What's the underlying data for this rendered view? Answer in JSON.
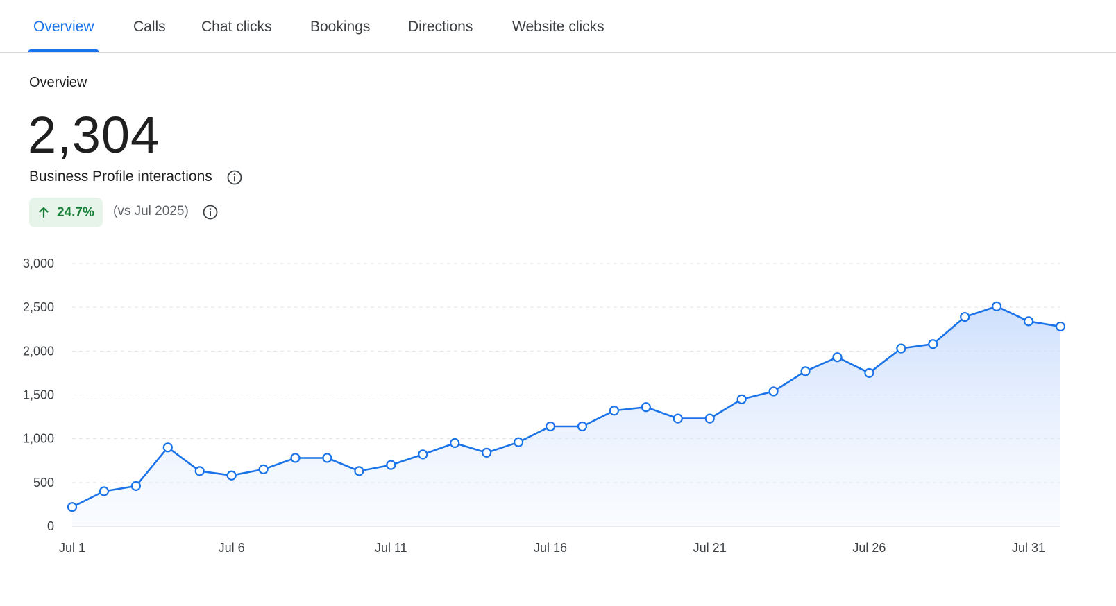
{
  "tabs": [
    {
      "label": "Overview",
      "active": true
    },
    {
      "label": "Calls",
      "active": false
    },
    {
      "label": "Chat clicks",
      "active": false
    },
    {
      "label": "Bookings",
      "active": false
    },
    {
      "label": "Directions",
      "active": false
    },
    {
      "label": "Website clicks",
      "active": false
    }
  ],
  "summary": {
    "section_label": "Overview",
    "total": "2,304",
    "metric_label": "Business Profile interactions",
    "delta": "24.7%",
    "delta_direction": "up",
    "comparison": "(vs Jul 2025)"
  },
  "icons": {
    "info": "info-icon",
    "delta": "arrow-up-icon"
  },
  "colors": {
    "accent": "#1a73e8",
    "positive": "#188038",
    "positive_bg": "#e6f4ea"
  },
  "chart_data": {
    "type": "area",
    "x": [
      "Jul 1",
      "Jul 2",
      "Jul 3",
      "Jul 4",
      "Jul 5",
      "Jul 6",
      "Jul 7",
      "Jul 8",
      "Jul 9",
      "Jul 10",
      "Jul 11",
      "Jul 12",
      "Jul 13",
      "Jul 14",
      "Jul 15",
      "Jul 16",
      "Jul 17",
      "Jul 18",
      "Jul 19",
      "Jul 20",
      "Jul 21",
      "Jul 22",
      "Jul 23",
      "Jul 24",
      "Jul 25",
      "Jul 26",
      "Jul 27",
      "Jul 28",
      "Jul 29",
      "Jul 30",
      "Jul 31"
    ],
    "series": [
      {
        "values": [
          220,
          400,
          460,
          900,
          630,
          580,
          650,
          780,
          780,
          630,
          700,
          820,
          950,
          840,
          960,
          1140,
          1140,
          1320,
          1360,
          1230,
          1230,
          1450,
          1540,
          1770,
          1930,
          1750,
          2030,
          2080,
          2390,
          2510,
          2340,
          2280
        ]
      }
    ],
    "x_tick_labels": [
      "Jul 1",
      "Jul 6",
      "Jul 11",
      "Jul 16",
      "Jul 21",
      "Jul 26",
      "Jul 31"
    ],
    "y_ticks": [
      0,
      500,
      1000,
      1500,
      2000,
      2500,
      3000
    ],
    "y_tick_labels": [
      "0",
      "500",
      "1,000",
      "1,500",
      "2,000",
      "2,500",
      "3,000"
    ],
    "ylim": [
      0,
      3000
    ],
    "grid": true,
    "legend": "none"
  }
}
